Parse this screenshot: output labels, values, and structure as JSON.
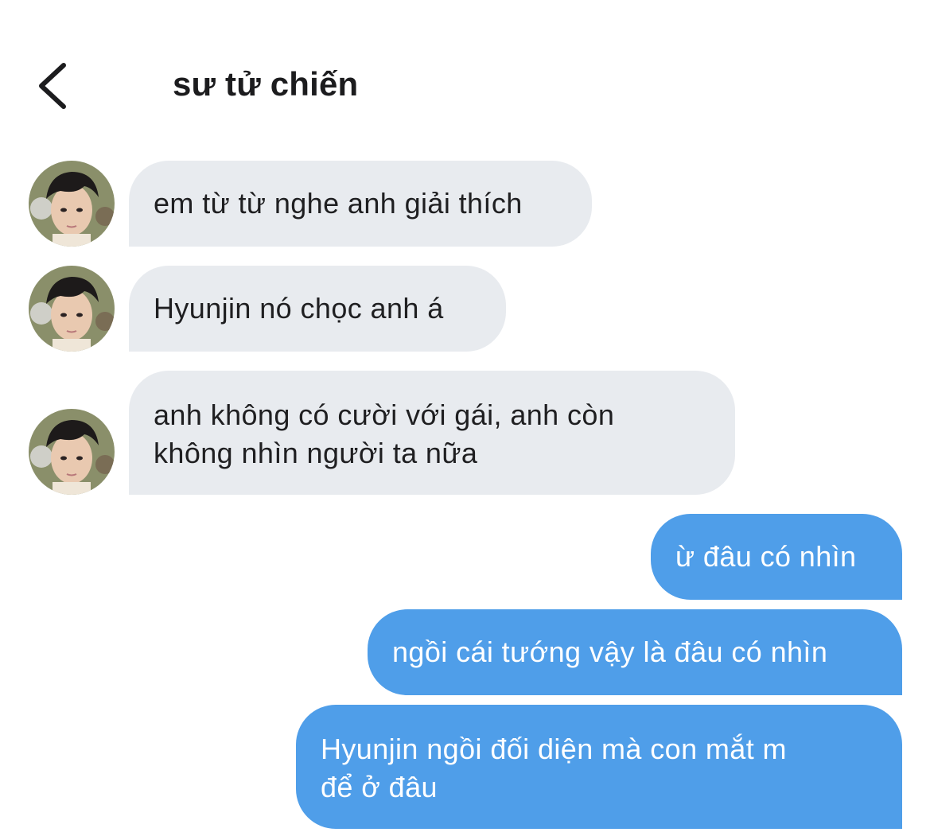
{
  "header": {
    "title": "sư tử chiến"
  },
  "colors": {
    "incoming_bubble": "#e8ebef",
    "outgoing_bubble": "#4f9ee9",
    "outgoing_text": "#ffffff",
    "incoming_text": "#1f1f21"
  },
  "messages": [
    {
      "sender": "contact",
      "text": "em từ từ nghe anh giải thích"
    },
    {
      "sender": "contact",
      "text": "Hyunjin nó chọc anh á"
    },
    {
      "sender": "contact",
      "text": "anh không có cười với gái, anh còn\nkhông nhìn người ta nữa"
    },
    {
      "sender": "me",
      "text": "ừ đâu có nhìn"
    },
    {
      "sender": "me",
      "text": "ngồi cái tướng vậy là đâu có nhìn"
    },
    {
      "sender": "me",
      "text": "Hyunjin ngồi đối diện mà con mắt m\nđể ở đâu"
    }
  ]
}
